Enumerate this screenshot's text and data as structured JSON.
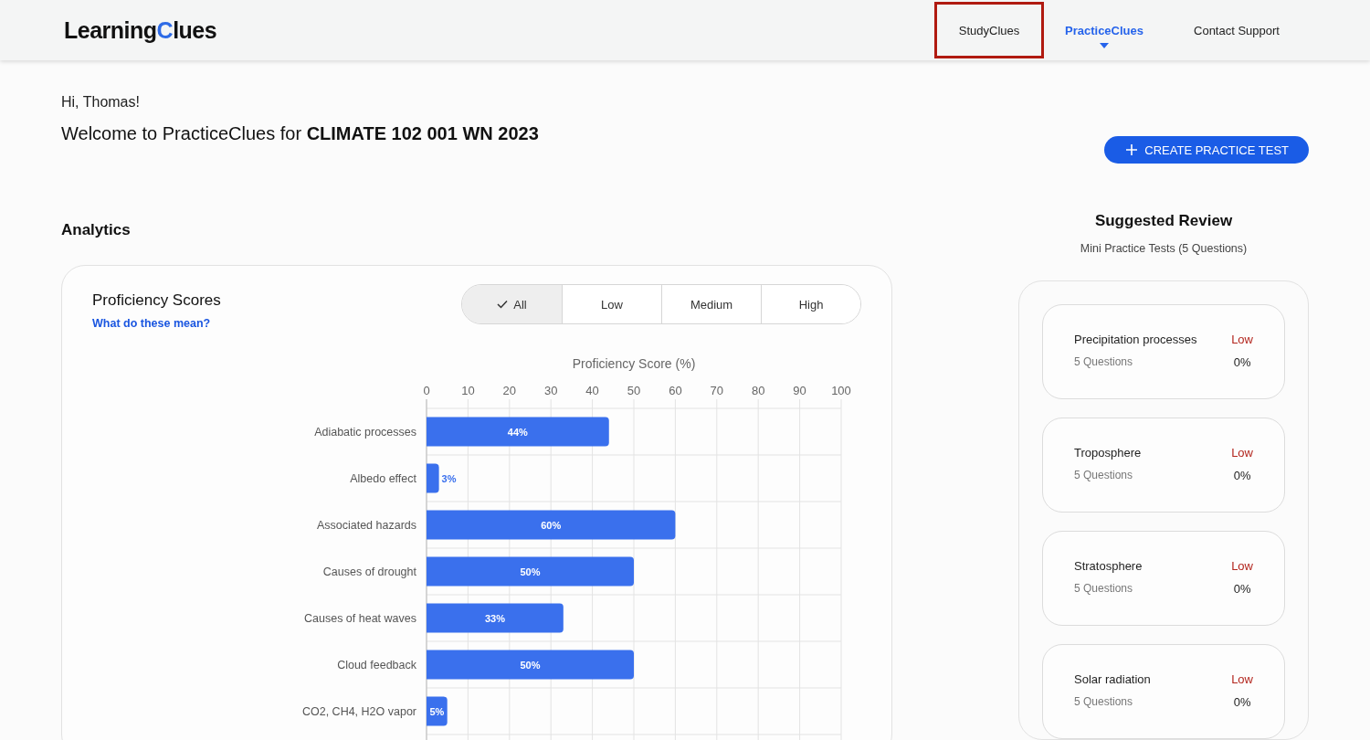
{
  "header": {
    "logo": [
      "Learning",
      "C",
      "lues"
    ],
    "nav": [
      {
        "label": "StudyClues",
        "selected": false,
        "highlighted": true
      },
      {
        "label": "PracticeClues",
        "selected": true,
        "highlighted": false
      },
      {
        "label": "Contact Support",
        "selected": false,
        "highlighted": false
      }
    ]
  },
  "greeting": "Hi, Thomas!",
  "welcome": "Welcome to PracticeClues for **CLIMATE 102 001 WN 2023**",
  "create_button": "CREATE PRACTICE TEST",
  "analytics": {
    "title": "Analytics",
    "card": {
      "title": "Proficiency Scores",
      "help_link": "What do these mean?",
      "filters": [
        {
          "label": "All",
          "selected": true
        },
        {
          "label": "Low",
          "selected": false
        },
        {
          "label": "Medium",
          "selected": false
        },
        {
          "label": "High",
          "selected": false
        }
      ],
      "chart_data": {
        "type": "bar",
        "orientation": "horizontal",
        "xlabel": "Proficiency Score (%)",
        "categories": [
          "Adiabatic processes",
          "Albedo effect",
          "Associated hazards",
          "Causes of drought",
          "Causes of heat waves",
          "Cloud feedback",
          "CO2, CH4, H2O vapor"
        ],
        "values": [
          44,
          3,
          60,
          50,
          33,
          50,
          5
        ],
        "xlim": [
          0,
          100
        ],
        "xticks": [
          0,
          10,
          20,
          30,
          40,
          50,
          60,
          70,
          80,
          90,
          100
        ],
        "grid": true,
        "value_labels": [
          "44%",
          "3%",
          "60%",
          "50%",
          "33%",
          "50%",
          "5%"
        ]
      }
    }
  },
  "suggested_review": {
    "title": "Suggested Review",
    "subtitle": "Mini Practice Tests (5 Questions)",
    "items": [
      {
        "topic": "Precipitation processes",
        "level": "Low",
        "questions": "5 Questions",
        "score": "0%"
      },
      {
        "topic": "Troposphere",
        "level": "Low",
        "questions": "5 Questions",
        "score": "0%"
      },
      {
        "topic": "Stratosphere",
        "level": "Low",
        "questions": "5 Questions",
        "score": "0%"
      },
      {
        "topic": "Solar radiation",
        "level": "Low",
        "questions": "5 Questions",
        "score": "0%"
      }
    ]
  }
}
